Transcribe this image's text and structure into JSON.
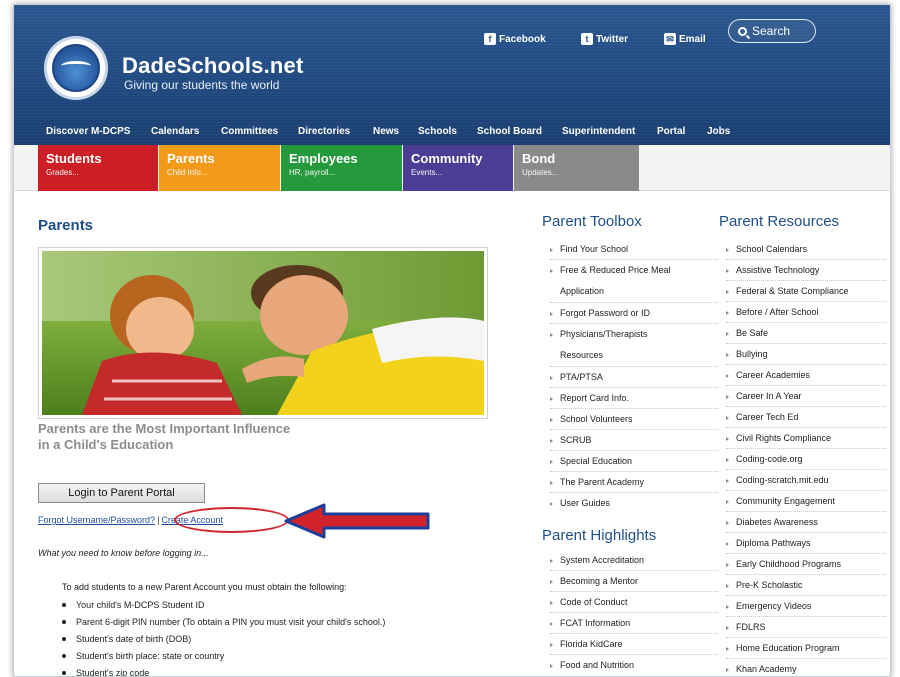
{
  "header": {
    "site_title": "DadeSchools.net",
    "tagline": "Giving our students the world",
    "social": [
      {
        "icon": "f",
        "label": "Facebook"
      },
      {
        "icon": "t",
        "label": "Twitter"
      },
      {
        "icon": "✉",
        "label": "Email"
      }
    ],
    "search_label": "Search",
    "nav": [
      "Discover M-DCPS",
      "Calendars",
      "Committees",
      "Directories",
      "News",
      "Schools",
      "School Board",
      "Superintendent",
      "Portal",
      "Jobs"
    ]
  },
  "tabs": [
    {
      "title": "Students",
      "sub": "Grades..."
    },
    {
      "title": "Parents",
      "sub": "Child Info..."
    },
    {
      "title": "Employees",
      "sub": "HR, payroll..."
    },
    {
      "title": "Community",
      "sub": "Events..."
    },
    {
      "title": "Bond",
      "sub": "Updates..."
    }
  ],
  "main": {
    "page_title": "Parents",
    "hero_caption": "Parents are the Most Important Influence in a Child's Education",
    "login_button": "Login to Parent Portal",
    "forgot_link": "Forgot Username/Password?",
    "link_separator": "|",
    "create_link": "Create Account",
    "before_login": "What you need to know before logging in...",
    "requirements_intro": "To add students to a new Parent Account you must obtain the following:",
    "requirements": [
      "Your child's M-DCPS Student ID",
      "Parent 6-digit PIN number (To obtain a PIN you must visit your child's school.)",
      "Student's date of birth (DOB)",
      "Student's birth place: state or country",
      "Student's zip code"
    ]
  },
  "toolbox": {
    "title": "Parent Toolbox",
    "items": [
      {
        "lines": [
          "Find Your School"
        ]
      },
      {
        "lines": [
          "Free & Reduced Price Meal",
          "Application"
        ]
      },
      {
        "lines": [
          "Forgot Password or ID"
        ]
      },
      {
        "lines": [
          "Physicians/Therapists",
          "Resources"
        ]
      },
      {
        "lines": [
          "PTA/PTSA"
        ]
      },
      {
        "lines": [
          "Report Card Info."
        ]
      },
      {
        "lines": [
          "School Volunteers"
        ]
      },
      {
        "lines": [
          "SCRUB"
        ]
      },
      {
        "lines": [
          "Special Education"
        ]
      },
      {
        "lines": [
          "The Parent Academy"
        ]
      },
      {
        "lines": [
          "User Guides"
        ]
      }
    ]
  },
  "highlights": {
    "title": "Parent Highlights",
    "items": [
      "System Accreditation",
      "Becoming a Mentor",
      "Code of Conduct",
      "FCAT Information",
      "Florida KidCare",
      "Food and Nutrition"
    ]
  },
  "resources": {
    "title": "Parent Resources",
    "items": [
      "School Calendars",
      "Assistive Technology",
      "Federal & State Compliance",
      "Before / After School",
      "Be Safe",
      "Bullying",
      "Career Academies",
      "Career In A Year",
      "Career Tech Ed",
      "Civil Rights Compliance",
      "Coding-code.org",
      "Coding-scratch.mit.edu",
      "Community Engagement",
      "Diabetes Awareness",
      "Diploma Pathways",
      "Early Childhood Programs",
      "Pre-K Scholastic",
      "Emergency Videos",
      "FDLRS",
      "Home Education Program",
      "Khan Academy"
    ]
  },
  "colors": {
    "students": "#cc1f25",
    "parents": "#f39a1a",
    "employees": "#249a3d",
    "community": "#4a3d94",
    "bond": "#8a8a8a",
    "header": "#224c84",
    "annotation": "#d2232a"
  }
}
